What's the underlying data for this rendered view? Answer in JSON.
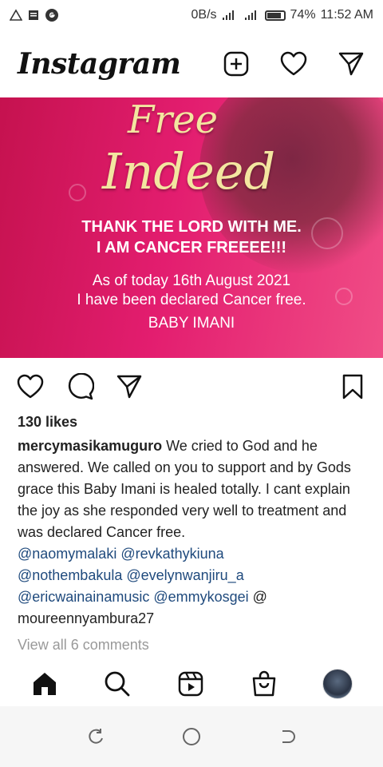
{
  "status_bar": {
    "net_speed": "0B/s",
    "battery": "74%",
    "time": "11:52 AM"
  },
  "header": {
    "logo": "Instagram",
    "icons": [
      "add-post-icon",
      "heart-icon",
      "direct-message-icon"
    ]
  },
  "post_image": {
    "title_line1": "Free",
    "title_line2": "Indeed",
    "thanks_line1": "THANK THE LORD WITH ME.",
    "thanks_line2": "I AM CANCER FREEEE!!!",
    "as_of_line1": "As of today 16th August 2021",
    "as_of_line2": "I have been declared Cancer free.",
    "name": "BABY IMANI",
    "colors": {
      "background": "#e31d6f",
      "title": "#f3e6a0"
    }
  },
  "actions": {
    "icons": [
      "heart-icon",
      "comment-icon",
      "share-icon",
      "bookmark-icon"
    ]
  },
  "likes": "130 likes",
  "caption": {
    "username": "mercymasikamuguro",
    "text": " We cried to God and he answered. We called on you to support and by Gods grace this Baby Imani is healed totally. I cant explain the joy as she responded very well to treatment and was declared Cancer free.",
    "mentions_line1": " @naomymalaki @revkathykiuna",
    "mentions_line2": " @nothembakula @evelynwanjiru_a",
    "mentions_line3": "@ericwainainamusic @emmykosgei",
    "mentions_line3_tail": " @",
    "mentions_line4": "moureennyambura27"
  },
  "view_all_comments": "View all 6 comments",
  "tab_bar": {
    "icons": [
      "home-icon",
      "search-icon",
      "reels-icon",
      "shop-icon",
      "profile-avatar"
    ]
  },
  "system_nav": {
    "icons": [
      "recents-icon",
      "home-circle-icon",
      "back-icon"
    ]
  }
}
